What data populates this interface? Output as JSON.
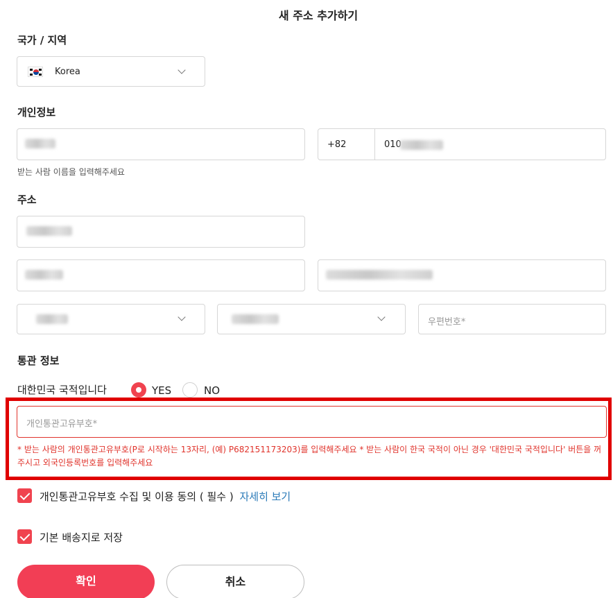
{
  "page_title": "새 주소 추가하기",
  "country_section": {
    "label": "국가 / 지역",
    "selected": "Korea",
    "flag_icon": "korea-flag-icon"
  },
  "personal_section": {
    "label": "개인정보",
    "country_code": "+82",
    "phone_prefix": "010",
    "name_helper": "받는 사람 이름을 입력해주세요"
  },
  "address_section": {
    "label": "주소",
    "postal_placeholder": "우편번호*"
  },
  "customs_section": {
    "label": "통관 정보",
    "nationality_question": "대한민국 국적입니다",
    "yes_label": "YES",
    "no_label": "NO",
    "customs_code_placeholder": "개인통관고유부호*",
    "error_message": "* 받는 사람의 개인통관고유부호(P로 시작하는 13자리, (예) P682151173203)를 입력해주세요 * 받는 사람이 한국 국적이 아닌 경우 '대한민국 국적입니다' 버튼을 꺼주시고 외국인등록번호를 입력해주세요"
  },
  "consent": {
    "label": "개인통관고유부호 수집 및 이용 동의 ( 필수 )",
    "detail_link": "자세히 보기"
  },
  "default_address": {
    "label": "기본 배송지로 저장"
  },
  "buttons": {
    "confirm": "확인",
    "cancel": "취소"
  },
  "colors": {
    "accent": "#f23e55",
    "error": "#e0332b",
    "link": "#2a7ab8"
  }
}
